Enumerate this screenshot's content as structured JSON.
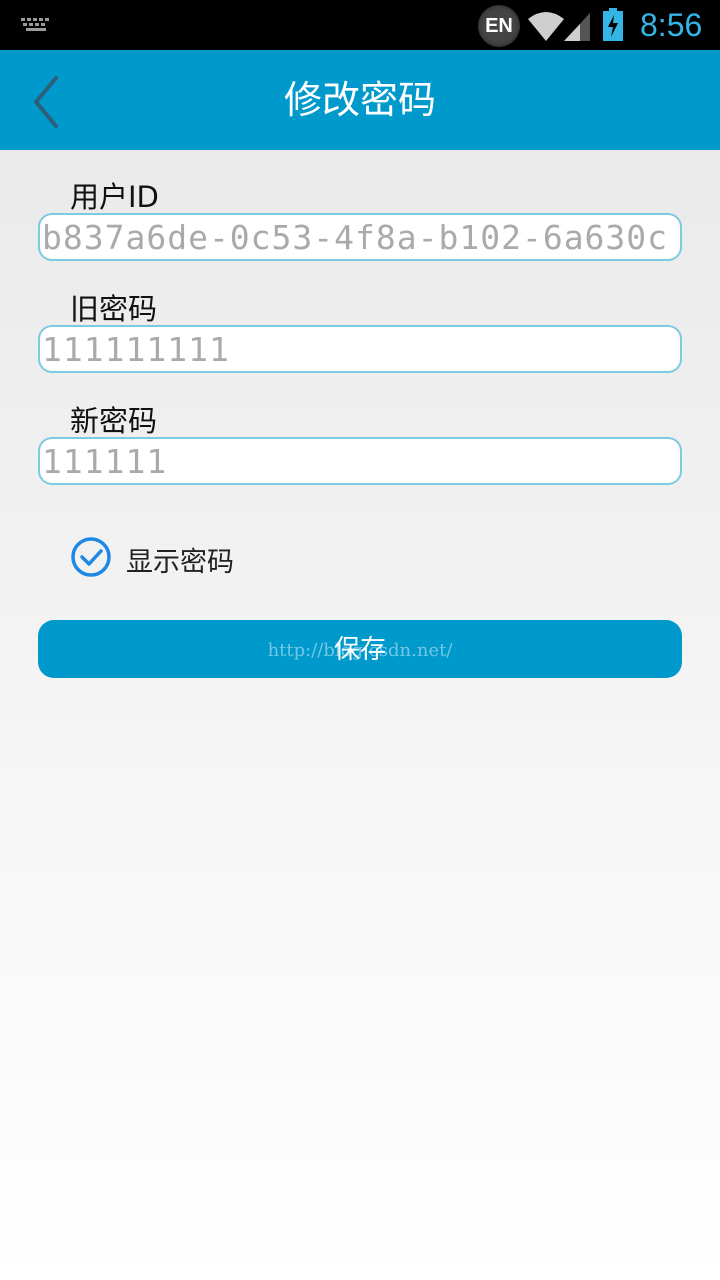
{
  "status_bar": {
    "input_method": "EN",
    "time": "8:56",
    "icons": [
      "keyboard-icon",
      "wifi-icon",
      "signal-icon",
      "battery-charging-icon"
    ]
  },
  "app_bar": {
    "title": "修改密码",
    "back_icon": "chevron-left-icon"
  },
  "form": {
    "user_id_label": "用户ID",
    "user_id_value": "b837a6de-0c53-4f8a-b102-6a630c",
    "old_password_label": "旧密码",
    "old_password_value": "111111111",
    "new_password_label": "新密码",
    "new_password_value": "111111",
    "show_password_label": "显示密码",
    "show_password_checked": true
  },
  "save_button": {
    "label": "保存",
    "watermark": "http://blog.csdn.net/"
  },
  "colors": {
    "accent": "#0099cc",
    "field_border": "#7ccbe2",
    "checkbox": "#1e88e5",
    "status_text": "#33b5e5"
  }
}
